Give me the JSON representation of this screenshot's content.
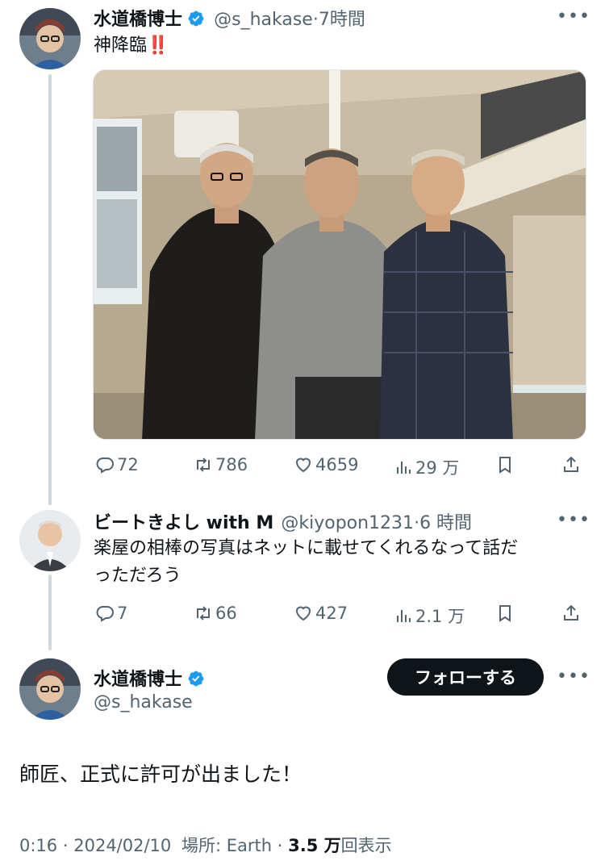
{
  "tweet1": {
    "name": "水道橋博士",
    "handle": "@s_hakase",
    "time": "7時間",
    "text": "神降臨",
    "emoji": "‼️",
    "stats": {
      "replies": "72",
      "retweets": "786",
      "likes": "4659",
      "views": "29 万"
    }
  },
  "tweet2": {
    "name": "ビートきよし with M",
    "handle": "@kiyopon1231",
    "time": "6 時間",
    "text_line1": "楽屋の相棒の写真はネットに載せてくれるなって話だ",
    "text_line2": "っただろう",
    "stats": {
      "replies": "7",
      "retweets": "66",
      "likes": "427",
      "views": "2.1 万"
    }
  },
  "main": {
    "name": "水道橋博士",
    "handle": "@s_hakase",
    "follow_label": "フォローする",
    "text": "師匠、正式に許可が出ました！",
    "time": "0:16",
    "date": "2024/02/10",
    "location": "場所: Earth",
    "views_count": "3.5 万",
    "views_suffix": "回表示"
  },
  "separators": {
    "dot": "·"
  },
  "more_label": "•••",
  "icons": {
    "verified": "verified-badge-icon",
    "reply": "reply-icon",
    "retweet": "retweet-icon",
    "like": "heart-icon",
    "views": "views-icon",
    "bookmark": "bookmark-icon",
    "share": "share-icon"
  },
  "colors": {
    "verified": "#1d9bf0",
    "text": "#0f1419",
    "muted": "#536471",
    "thread": "#cfd9de"
  }
}
